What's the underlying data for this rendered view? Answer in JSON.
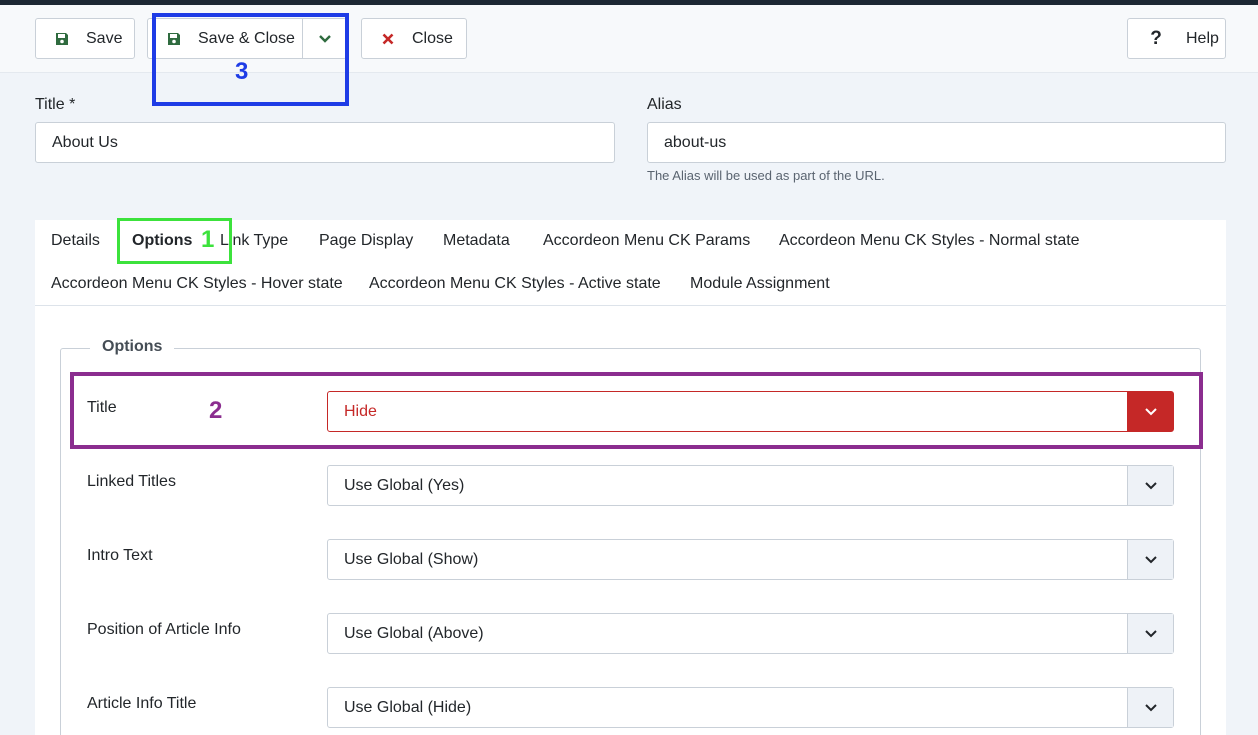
{
  "toolbar": {
    "save_label": "Save",
    "save_close_label": "Save & Close",
    "close_label": "Close",
    "help_label": "Help"
  },
  "form": {
    "title_label": "Title *",
    "title_value": "About Us",
    "alias_label": "Alias",
    "alias_value": "about-us",
    "alias_hint": "The Alias will be used as part of the URL."
  },
  "tabs": [
    {
      "label": "Details"
    },
    {
      "label": "Options",
      "active": true
    },
    {
      "label": "Link Type"
    },
    {
      "label": "Page Display"
    },
    {
      "label": "Metadata"
    },
    {
      "label": "Accordeon Menu CK Params"
    },
    {
      "label": "Accordeon Menu CK Styles - Normal state"
    },
    {
      "label": "Accordeon Menu CK Styles - Hover state"
    },
    {
      "label": "Accordeon Menu CK Styles - Active state"
    },
    {
      "label": "Module Assignment"
    }
  ],
  "options": {
    "legend": "Options",
    "rows": [
      {
        "label": "Title",
        "value": "Hide"
      },
      {
        "label": "Linked Titles",
        "value": "Use Global (Yes)"
      },
      {
        "label": "Intro Text",
        "value": "Use Global (Show)"
      },
      {
        "label": "Position of Article Info",
        "value": "Use Global (Above)"
      },
      {
        "label": "Article Info Title",
        "value": "Use Global (Hide)"
      }
    ]
  },
  "annotations": [
    {
      "number": "1",
      "color": "#3ce23c"
    },
    {
      "number": "2",
      "color": "#8b2d8f"
    },
    {
      "number": "3",
      "color": "#1e3ce6"
    }
  ],
  "colors": {
    "save_icon": "#2f6b3f",
    "close_icon": "#c52827",
    "invalid": "#c52827"
  },
  "icons": {
    "save": "floppy-disk-icon",
    "close": "x-icon",
    "help": "question-icon",
    "dropdown": "chevron-down-icon"
  }
}
